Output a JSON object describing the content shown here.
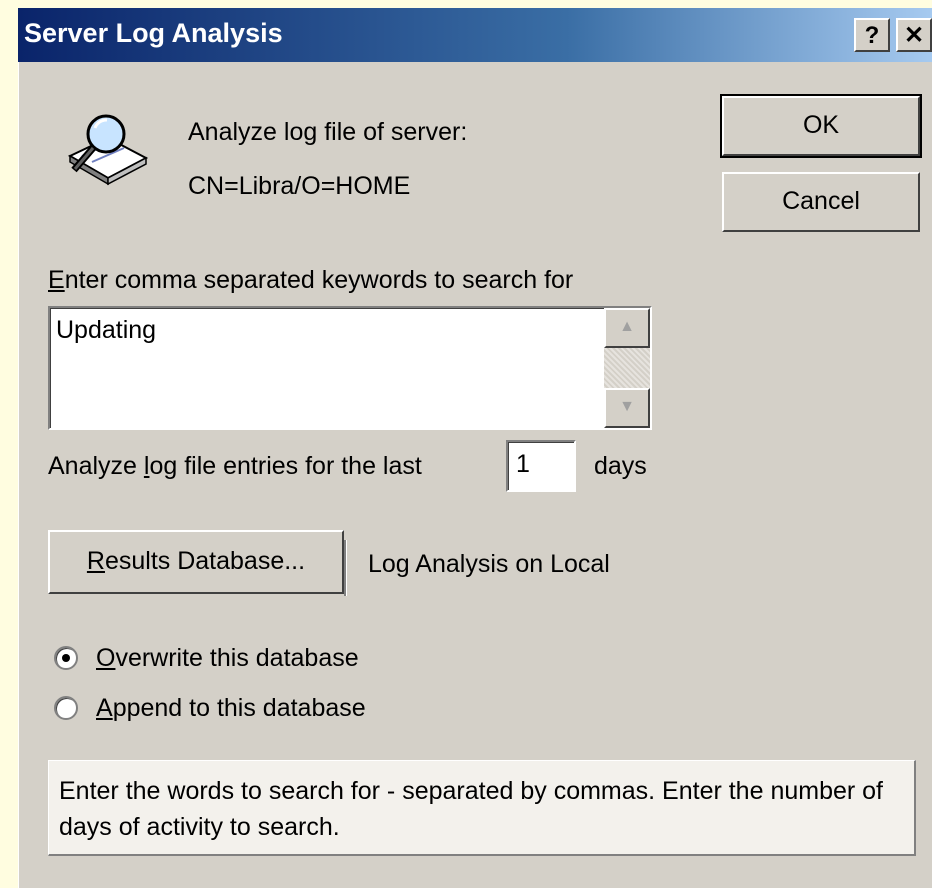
{
  "window": {
    "title": "Server Log Analysis",
    "help_glyph": "?",
    "close_glyph": "✕"
  },
  "header": {
    "icon": "magnifier-on-book-icon",
    "line1": "Analyze log file of server:",
    "server_name": "CN=Libra/O=HOME"
  },
  "buttons": {
    "ok": "OK",
    "cancel": "Cancel"
  },
  "keywords": {
    "label_mnemonic": "E",
    "label_rest": "nter comma separated keywords to search for",
    "value": "Updating",
    "scroll_up": "▲",
    "scroll_down": "▼"
  },
  "days": {
    "label_before": "Analyze ",
    "label_mnemonic": "l",
    "label_after": "og file entries for the last",
    "value": "1",
    "unit": "days"
  },
  "results": {
    "button_mnemonic": "R",
    "button_rest": "esults Database...",
    "database_label": "Log Analysis on Local"
  },
  "options": [
    {
      "mnemonic": "O",
      "rest": "verwrite this database",
      "selected": true
    },
    {
      "mnemonic": "A",
      "rest": "ppend to this database",
      "selected": false
    }
  ],
  "hint": {
    "text": "Enter the words to search for - separated by commas. Enter the number of days of activity to search."
  },
  "colors": {
    "titlebar_start": "#0a246a",
    "titlebar_end": "#a6caf0",
    "dialog_face": "#d4d0c8"
  }
}
